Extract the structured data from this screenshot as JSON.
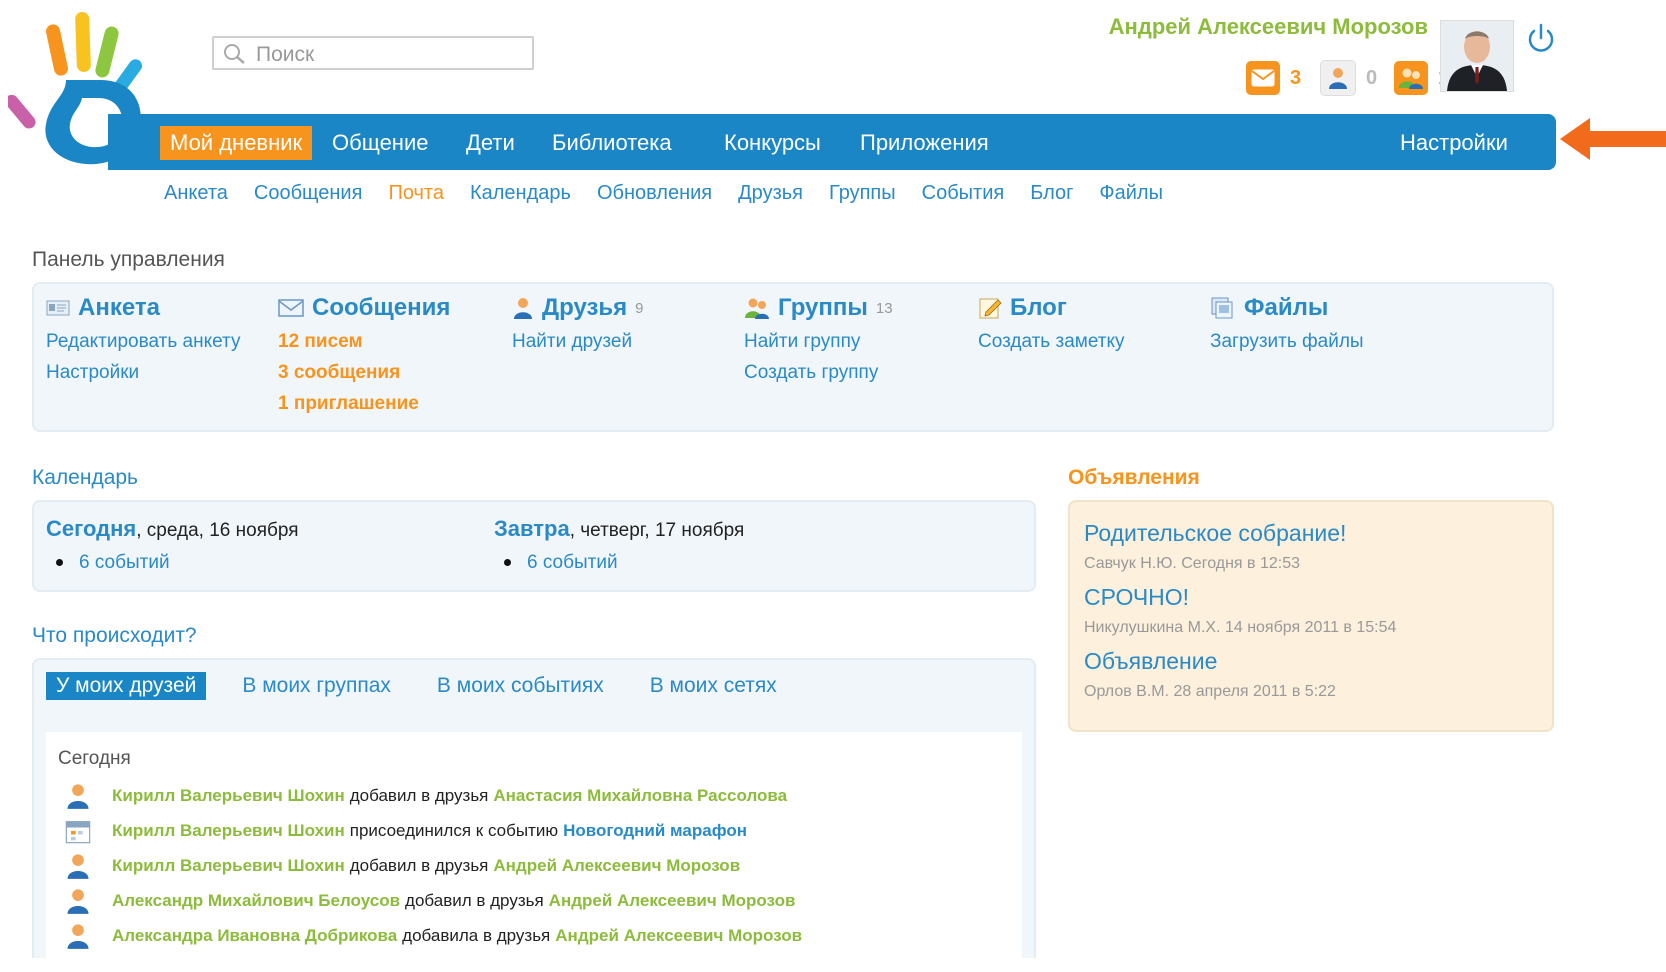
{
  "search": {
    "placeholder": "Поиск"
  },
  "user": {
    "name": "Андрей Алексеевич Морозов"
  },
  "counters": [
    {
      "icon": "mail-icon",
      "count": "3",
      "color": "#f7941d"
    },
    {
      "icon": "friend-request-icon",
      "count": "0",
      "color": "#cccccc"
    },
    {
      "icon": "group-icon",
      "count": "1",
      "color": "#f7941d"
    }
  ],
  "topnav": {
    "items": [
      "Мой дневник",
      "Общение",
      "Дети",
      "Библиотека",
      "Конкурсы",
      "Приложения"
    ],
    "active": "Мой дневник",
    "settings": "Настройки"
  },
  "subnav": {
    "items": [
      "Анкета",
      "Сообщения",
      "Почта",
      "Календарь",
      "Обновления",
      "Друзья",
      "Группы",
      "События",
      "Блог",
      "Файлы"
    ],
    "active": "Почта"
  },
  "control_panel": {
    "title": "Панель управления",
    "columns": [
      {
        "title": "Анкета",
        "icon": "profile-card-icon",
        "count": "",
        "links": [
          "Редактировать анкету",
          "Настройки"
        ]
      },
      {
        "title": "Сообщения",
        "icon": "envelope-icon",
        "count": "",
        "links": [
          "12 писем",
          "3 сообщения",
          "1 приглашение"
        ]
      },
      {
        "title": "Друзья",
        "icon": "person-icon",
        "count": "9",
        "links": [
          "Найти друзей"
        ]
      },
      {
        "title": "Группы",
        "icon": "people-group-icon",
        "count": "13",
        "links": [
          "Найти группу",
          "Создать группу"
        ]
      },
      {
        "title": "Блог",
        "icon": "pencil-note-icon",
        "count": "",
        "links": [
          "Создать заметку"
        ]
      },
      {
        "title": "Файлы",
        "icon": "files-icon",
        "count": "",
        "links": [
          "Загрузить файлы"
        ]
      }
    ]
  },
  "calendar": {
    "title": "Календарь",
    "today": {
      "label": "Сегодня",
      "date": ", среда, 16 ноября",
      "events": "6 событий"
    },
    "tomorrow": {
      "label": "Завтра",
      "date": ", четверг, 17 ноября",
      "events": "6 событий"
    }
  },
  "announcements": {
    "title": "Объявления",
    "items": [
      {
        "title": "Родительское собрание!",
        "meta": "Савчук Н.Ю. Сегодня в 12:53"
      },
      {
        "title": "СРОЧНО!",
        "meta": "Никулушкина М.Х. 14 ноября 2011 в 15:54"
      },
      {
        "title": "Объявление",
        "meta": "Орлов В.М. 28 апреля 2011 в 5:22"
      }
    ]
  },
  "feed": {
    "title": "Что происходит?",
    "tabs": [
      "У моих друзей",
      "В моих группах",
      "В моих событиях",
      "В моих сетях"
    ],
    "active_tab": "У моих друзей",
    "day": "Сегодня",
    "rows": [
      {
        "icon": "person-icon",
        "user": "Кирилл Валерьевич Шохин",
        "action": "добавил в друзья",
        "target": "Анастасия Михайловна Рассолова",
        "target_kind": "person"
      },
      {
        "icon": "calendar-event-icon",
        "user": "Кирилл Валерьевич Шохин",
        "action": "присоединился к событию",
        "target": "Новогодний марафон",
        "target_kind": "event"
      },
      {
        "icon": "person-icon",
        "user": "Кирилл Валерьевич Шохин",
        "action": "добавил в друзья",
        "target": "Андрей Алексеевич Морозов",
        "target_kind": "person"
      },
      {
        "icon": "person-icon",
        "user": "Александр Михайлович Белоусов",
        "action": "добавил в друзья",
        "target": "Андрей Алексеевич Морозов",
        "target_kind": "person"
      },
      {
        "icon": "person-icon",
        "user": "Александра Ивановна Добрикова",
        "action": "добавила в друзья",
        "target": "Андрей Алексеевич Морозов",
        "target_kind": "person"
      }
    ]
  },
  "colors": {
    "accent_blue": "#1a86c6",
    "link_blue": "#2a8ac6",
    "orange": "#f7941d",
    "green": "#8dbb3c"
  }
}
